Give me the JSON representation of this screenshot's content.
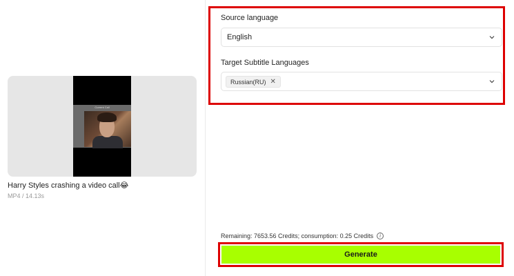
{
  "video": {
    "title": "Harry Styles crashing a video call😂",
    "meta": "MP4 / 14.13s",
    "call_overlay_text": "Current Call"
  },
  "settings": {
    "source_label": "Source language",
    "source_value": "English",
    "target_label": "Target Subtitle Languages",
    "target_chips": [
      {
        "label": "Russian(RU)"
      }
    ]
  },
  "footer": {
    "remaining_text": "Remaining: 7653.56 Credits; consumption: 0.25 Credits",
    "generate_label": "Generate"
  },
  "colors": {
    "highlight_border": "#dd0000",
    "generate_bg": "#a8ff00"
  },
  "icons": {
    "chevron": "chevron-down-icon",
    "chip_close": "close-icon",
    "info": "info-icon"
  }
}
